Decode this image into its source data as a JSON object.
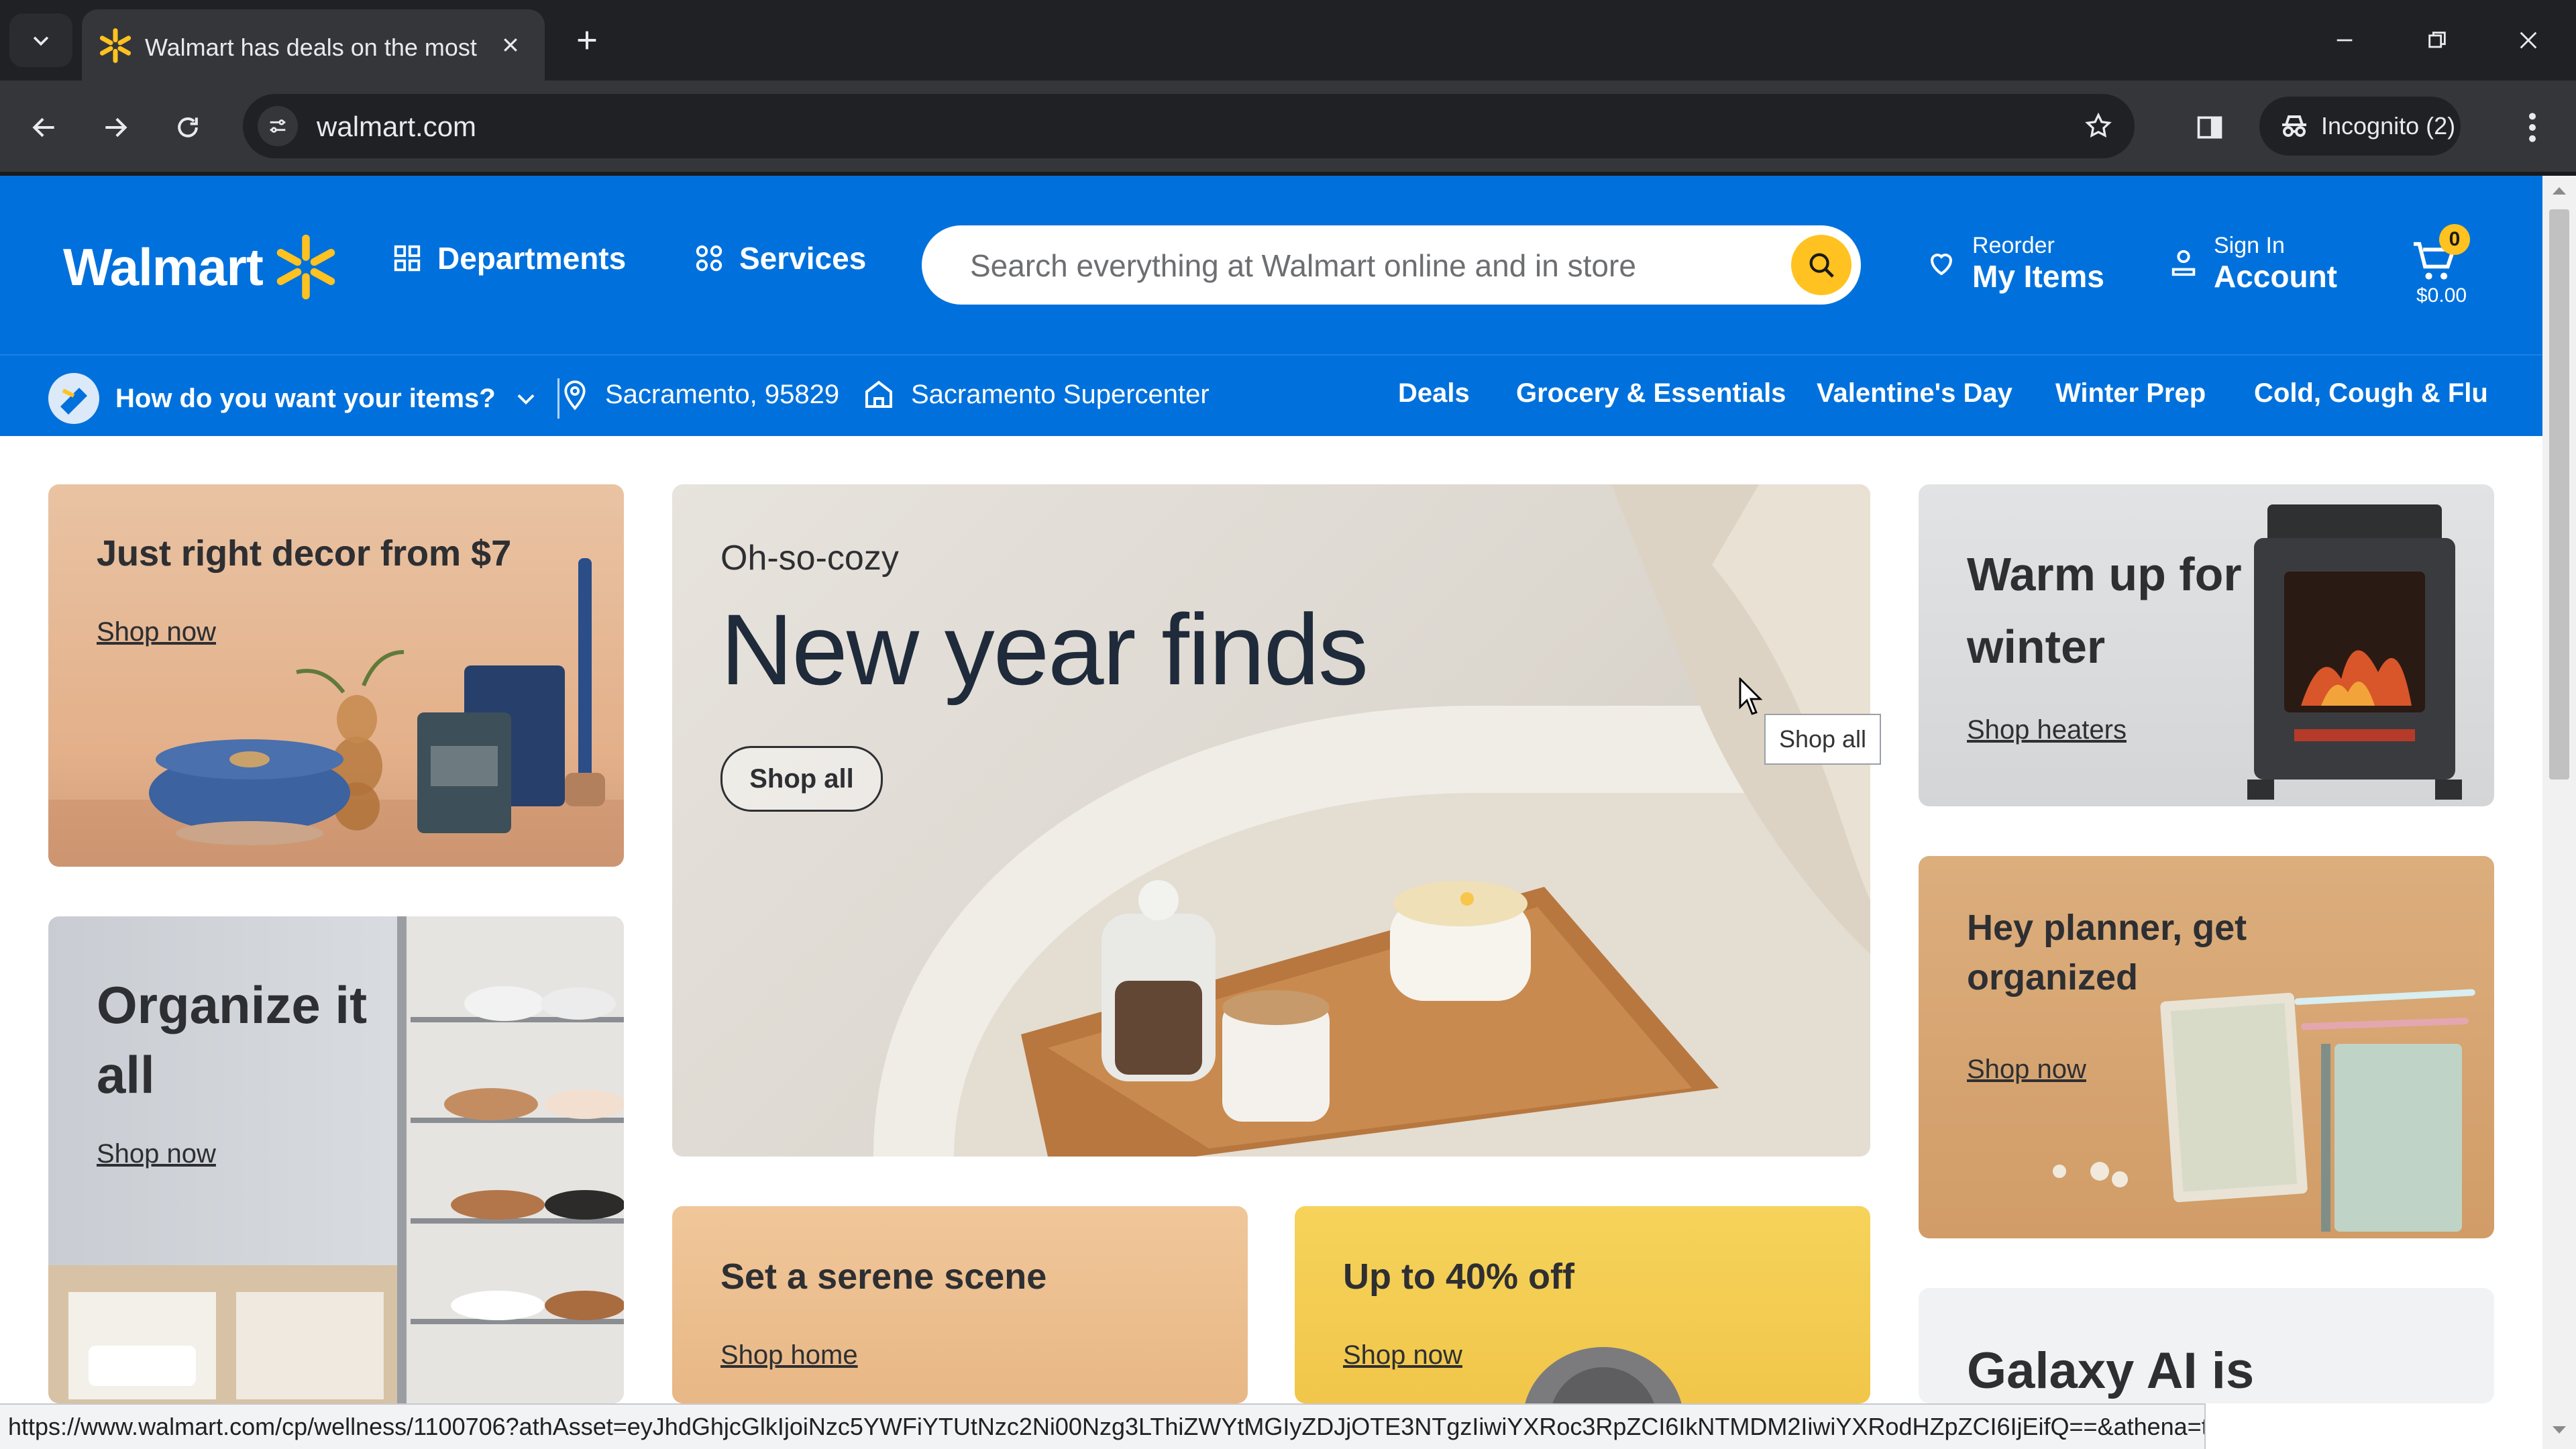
{
  "browser": {
    "tab_title": "Walmart has deals on the most",
    "url": "walmart.com",
    "incognito_label": "Incognito (2)",
    "status_url": "https://www.walmart.com/cp/wellness/1100706?athAsset=eyJhdGhjcGlkIjoiNzc5YWFiYTUtNzc2Ni00Nzg3LThiZWYtMGIyZDJjOTE3NTgzIiwiYXRoc3RpZCI6IkNTMDM2IiwiYXRodHZpZCI6IjEifQ==&athena=true"
  },
  "header": {
    "logo_text": "Walmart",
    "departments": "Departments",
    "services": "Services",
    "search_placeholder": "Search everything at Walmart online and in store",
    "reorder_small": "Reorder",
    "reorder_big": "My Items",
    "signin_small": "Sign In",
    "signin_big": "Account",
    "cart_count": "0",
    "cart_total": "$0.00"
  },
  "subbar": {
    "fulfillment": "How do you want your items?",
    "location": "Sacramento, 95829",
    "store": "Sacramento Supercenter",
    "links": [
      "Deals",
      "Grocery & Essentials",
      "Valentine's Day",
      "Winter Prep",
      "Cold, Cough & Flu"
    ]
  },
  "cards": {
    "decor": {
      "title": "Just right decor from $7",
      "link": "Shop now"
    },
    "organize": {
      "title": "Organize it all",
      "link": "Shop now"
    },
    "hero": {
      "kicker": "Oh-so-cozy",
      "title": "New year finds",
      "button": "Shop all",
      "tooltip": "Shop all"
    },
    "winter": {
      "title": "Warm up for winter",
      "link": "Shop heaters"
    },
    "planner": {
      "title": "Hey planner, get organized",
      "link": "Shop now"
    },
    "serene": {
      "title": "Set a serene scene",
      "link": "Shop home"
    },
    "sale": {
      "title": "Up to 40% off",
      "link": "Shop now"
    },
    "galaxy": {
      "title": "Galaxy AI is"
    }
  },
  "colors": {
    "brand_blue": "#0071dc",
    "spark_yellow": "#ffc220"
  }
}
